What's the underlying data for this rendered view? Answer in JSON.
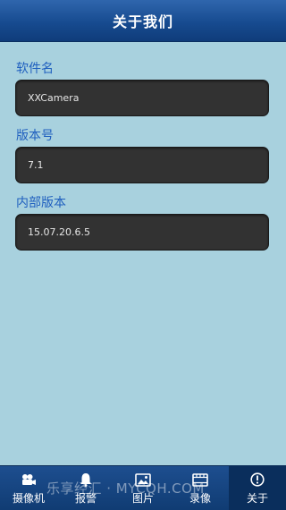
{
  "header": {
    "title": "关于我们"
  },
  "fields": [
    {
      "label": "软件名",
      "value": "XXCamera"
    },
    {
      "label": "版本号",
      "value": "7.1"
    },
    {
      "label": "内部版本",
      "value": "15.07.20.6.5"
    }
  ],
  "tabbar": {
    "items": [
      {
        "label": "摄像机",
        "icon": "camera-icon",
        "active": false
      },
      {
        "label": "报警",
        "icon": "alarm-bell-icon",
        "active": false
      },
      {
        "label": "图片",
        "icon": "picture-icon",
        "active": false
      },
      {
        "label": "录像",
        "icon": "video-record-icon",
        "active": false
      },
      {
        "label": "关于",
        "icon": "info-icon",
        "active": true
      }
    ]
  },
  "watermark": "乐享经汇 · MYCQH.COM",
  "colors": {
    "background": "#a8d1de",
    "header": "#174b90",
    "label": "#1f5fbf",
    "field_box": "#323232",
    "tab_active": "#0a2e5c"
  }
}
